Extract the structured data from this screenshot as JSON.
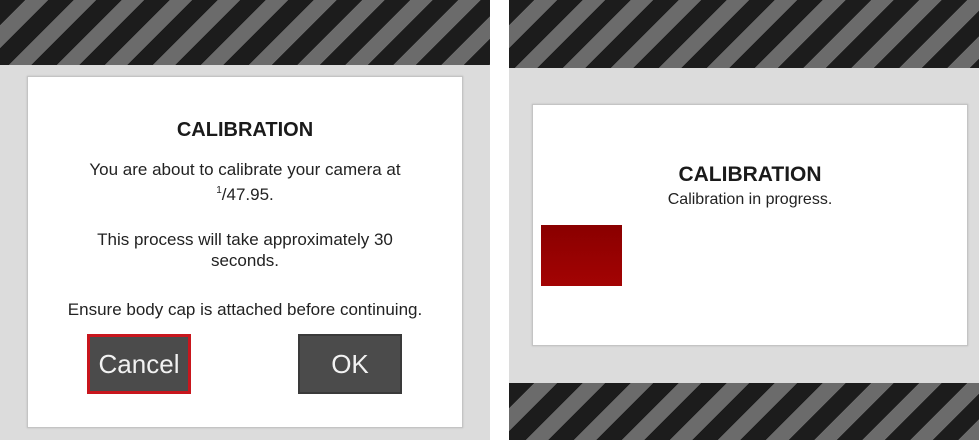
{
  "colors": {
    "stripe_dark": "#1c1c1c",
    "stripe_light": "#6b6b6b",
    "button_bg": "#4b4b4b",
    "focus_border": "#c8161d",
    "progress_fill": "#9a0202"
  },
  "confirm_dialog": {
    "title": "CALIBRATION",
    "line1": "You are about to calibrate your camera at",
    "shutter_numerator": "1",
    "shutter_denominator": "47.95.",
    "line2": "This process will take approximately 30 seconds.",
    "line3": "Ensure body cap is attached before continuing.",
    "cancel_label": "Cancel",
    "ok_label": "OK",
    "focused_button": "cancel"
  },
  "progress_dialog": {
    "title": "CALIBRATION",
    "subtitle": "Calibration in progress.",
    "progress_fraction": 0.19
  }
}
